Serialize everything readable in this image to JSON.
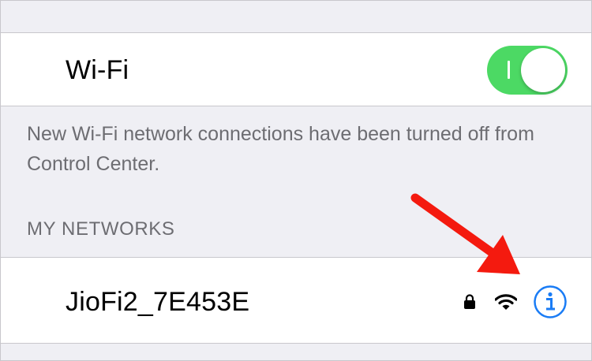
{
  "wifi": {
    "label": "Wi-Fi",
    "enabled": true
  },
  "footer_note": "New Wi-Fi network connections have been turned off from Control Center.",
  "section_header": "MY NETWORKS",
  "networks": [
    {
      "name": "JioFi2_7E453E",
      "secured": true
    }
  ],
  "icons": {
    "lock": "lock-icon",
    "wifi": "wifi-signal-icon",
    "info": "info-icon",
    "arrow": "red-arrow-annotation"
  },
  "colors": {
    "toggle_on": "#4cd964",
    "info_blue": "#1a7cf5",
    "arrow_red": "#f41a0f",
    "background": "#efeff4",
    "secondary_text": "#6d6d72"
  }
}
